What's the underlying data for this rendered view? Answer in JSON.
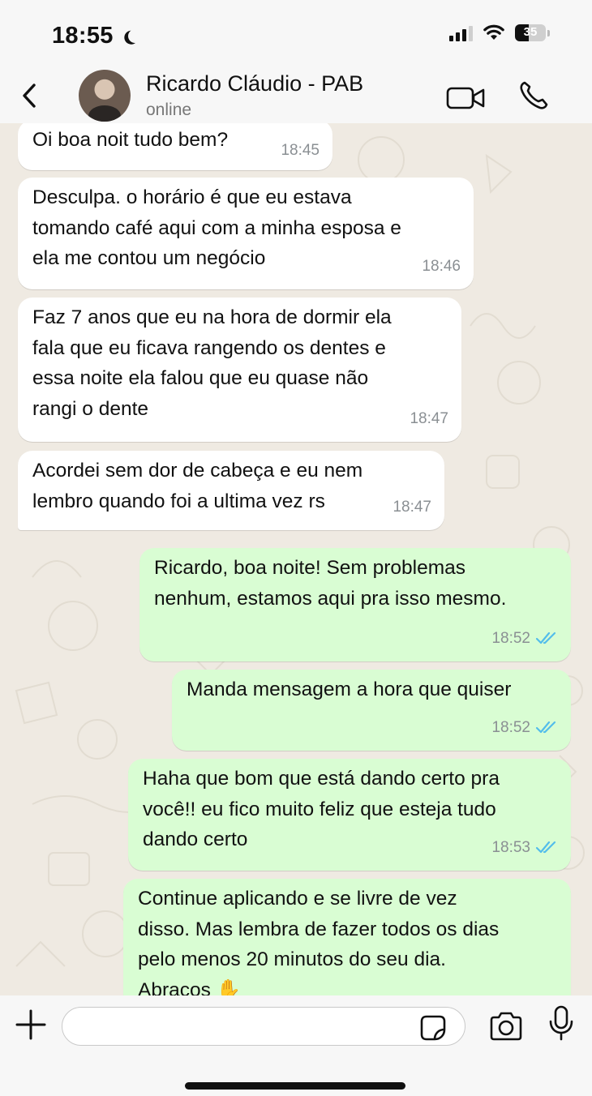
{
  "status_bar": {
    "time": "18:55",
    "battery_level": "35",
    "icons": [
      "moon-icon",
      "signal-icon",
      "wifi-icon",
      "battery-icon"
    ]
  },
  "header": {
    "contact_name": "Ricardo Cláudio - PAB",
    "status": "online",
    "icons": [
      "back-chevron-icon",
      "video-call-icon",
      "phone-icon"
    ]
  },
  "messages": [
    {
      "direction": "in",
      "text": "Oi boa noit tudo bem?",
      "time": "18:45"
    },
    {
      "direction": "in",
      "text": "Desculpa. o horário é que eu estava\ntomando café aqui com a minha esposa e\nela me contou um negócio",
      "time": "18:46"
    },
    {
      "direction": "in",
      "text": "Faz 7 anos que eu na hora de dormir ela\nfala que eu ficava rangendo os dentes e\nessa noite ela falou que eu quase não\nrangi o dente",
      "time": "18:47"
    },
    {
      "direction": "in",
      "text": "Acordei sem dor de cabeça e eu nem\nlembro quando foi a ultima vez rs",
      "time": "18:47"
    },
    {
      "direction": "out",
      "text": "Ricardo, boa noite! Sem problemas\nnenhum, estamos aqui pra isso mesmo.",
      "time": "18:52",
      "read": true
    },
    {
      "direction": "out",
      "text": "Manda mensagem a hora que quiser",
      "time": "18:52",
      "read": true
    },
    {
      "direction": "out",
      "text": "Haha que bom que está dando certo pra\nvocê!! eu fico muito feliz que esteja tudo\ndando certo",
      "time": "18:53",
      "read": true
    },
    {
      "direction": "out",
      "text": "Continue aplicando e se livre de vez\ndisso. Mas lembra de fazer todos os dias\npelo menos 20 minutos do seu dia.\nAbraços ✋",
      "time": "",
      "read": false
    }
  ],
  "input_bar": {
    "message_value": "",
    "icons": [
      "plus-icon",
      "sticker-icon",
      "camera-icon",
      "microphone-icon"
    ]
  },
  "colors": {
    "incoming_bubble": "#ffffff",
    "outgoing_bubble": "#d9fdd3",
    "read_ticks": "#53bdeb",
    "chat_wallpaper": "#efeae2"
  }
}
